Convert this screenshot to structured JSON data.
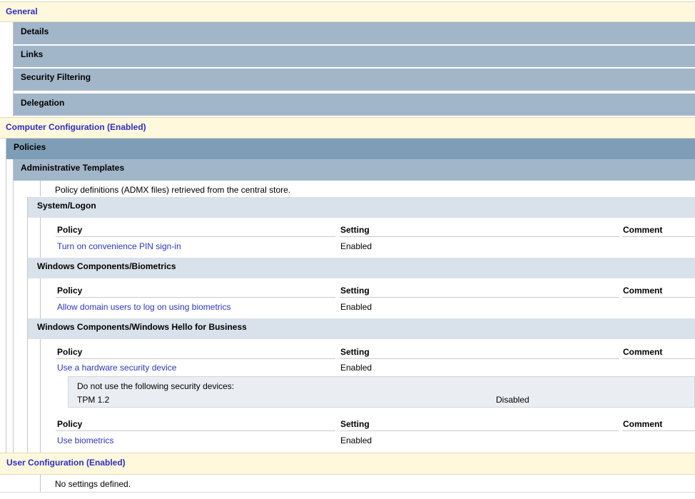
{
  "general": {
    "label": "General"
  },
  "general_items": [
    "Details",
    "Links",
    "Security Filtering",
    "Delegation"
  ],
  "computer_config": {
    "label": "Computer Configuration (Enabled)"
  },
  "policies": {
    "label": "Policies"
  },
  "admin_templates": {
    "label": "Administrative Templates",
    "note": "Policy definitions (ADMX files) retrieved from the central store."
  },
  "table_headers": {
    "policy": "Policy",
    "setting": "Setting",
    "comment": "Comment"
  },
  "groups": [
    {
      "label": "System/Logon",
      "rows": [
        {
          "policy": "Turn on convenience PIN sign-in",
          "setting": "Enabled"
        }
      ]
    },
    {
      "label": "Windows Components/Biometrics",
      "rows": [
        {
          "policy": "Allow domain users to log on using biometrics",
          "setting": "Enabled"
        }
      ]
    },
    {
      "label": "Windows Components/Windows Hello for Business",
      "rows": [
        {
          "policy": "Use a hardware security device",
          "setting": "Enabled"
        },
        {
          "policy": "Use biometrics",
          "setting": "Enabled"
        }
      ],
      "detail": {
        "heading": "Do not use the following security devices:",
        "item": "TPM 1.2",
        "value": "Disabled"
      }
    }
  ],
  "user_config": {
    "label": "User Configuration (Enabled)",
    "note": "No settings defined."
  }
}
